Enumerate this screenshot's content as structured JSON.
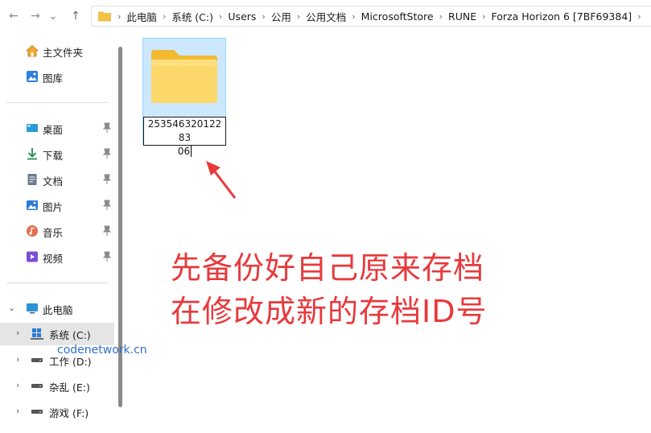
{
  "nav": {
    "back": "←",
    "forward": "→",
    "recent": "⌄",
    "up": "↑"
  },
  "breadcrumb": [
    "此电脑",
    "系统 (C:)",
    "Users",
    "公用",
    "公用文档",
    "MicrosoftStore",
    "RUNE",
    "Forza Horizon 6 [7BF69384]"
  ],
  "sidebar": {
    "home": "主文件夹",
    "gallery": "图库",
    "pinned": [
      "桌面",
      "下载",
      "文档",
      "图片",
      "音乐",
      "视频"
    ],
    "this_pc": "此电脑",
    "drives": [
      "系统 (C:)",
      "工作 (D:)",
      "杂乱 (E:)",
      "游戏 (F:)"
    ]
  },
  "folder": {
    "name_line1": "25354632012283",
    "name_line2": "06"
  },
  "annotation": {
    "line1": "先备份好自己原来存档",
    "line2": "在修改成新的存档ID号"
  },
  "watermark": "codenetwork.cn",
  "colors": {
    "annotation": "#e8393c",
    "selection": "#cce8ff",
    "folder": "#f8c951"
  }
}
